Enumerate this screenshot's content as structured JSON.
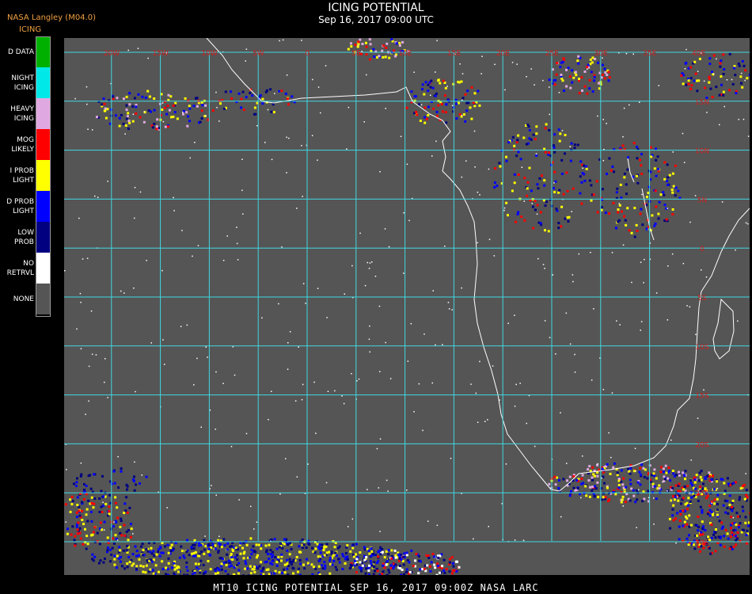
{
  "header": {
    "brand": "NASA Langley (M04.0)",
    "product": "ICING",
    "title": "ICING POTENTIAL",
    "subtitle": "Sep 16, 2017 09:00 UTC"
  },
  "legend": [
    {
      "lines": [
        "D DATA"
      ],
      "color": "#00b000"
    },
    {
      "lines": [
        "NIGHT",
        "ICING"
      ],
      "color": "#00e8e8"
    },
    {
      "lines": [
        "HEAVY",
        "ICING"
      ],
      "color": "#e0a8e0"
    },
    {
      "lines": [
        "MOG",
        "LIKELY"
      ],
      "color": "#ff0000"
    },
    {
      "lines": [
        "I PROB",
        "LIGHT"
      ],
      "color": "#ffff00"
    },
    {
      "lines": [
        "D PROB",
        "LIGHT"
      ],
      "color": "#0000ff"
    },
    {
      "lines": [
        "LOW",
        "PROB"
      ],
      "color": "#000080"
    },
    {
      "lines": [
        "NO",
        "RETRVL"
      ],
      "color": "#ffffff"
    },
    {
      "lines": [
        "NONE"
      ],
      "color": "#555555"
    }
  ],
  "map": {
    "background": "#555555",
    "grid_color": "#40d8e0",
    "coast_color": "#ffffff",
    "label_color": "#d02020",
    "longitude_labels": [
      "20W",
      "15W",
      "10W",
      "5W",
      "0",
      "5E",
      "10E",
      "15E",
      "20E",
      "25E",
      "30E",
      "35E",
      "40E"
    ],
    "latitude_labels": [
      "15N",
      "10N",
      "5N",
      "0",
      "5S",
      "10S",
      "15S",
      "20S",
      "25S",
      "30S"
    ]
  },
  "footer": {
    "text": "MT10  ICING POTENTIAL   SEP 16, 2017 09:00Z   NASA LARC"
  }
}
